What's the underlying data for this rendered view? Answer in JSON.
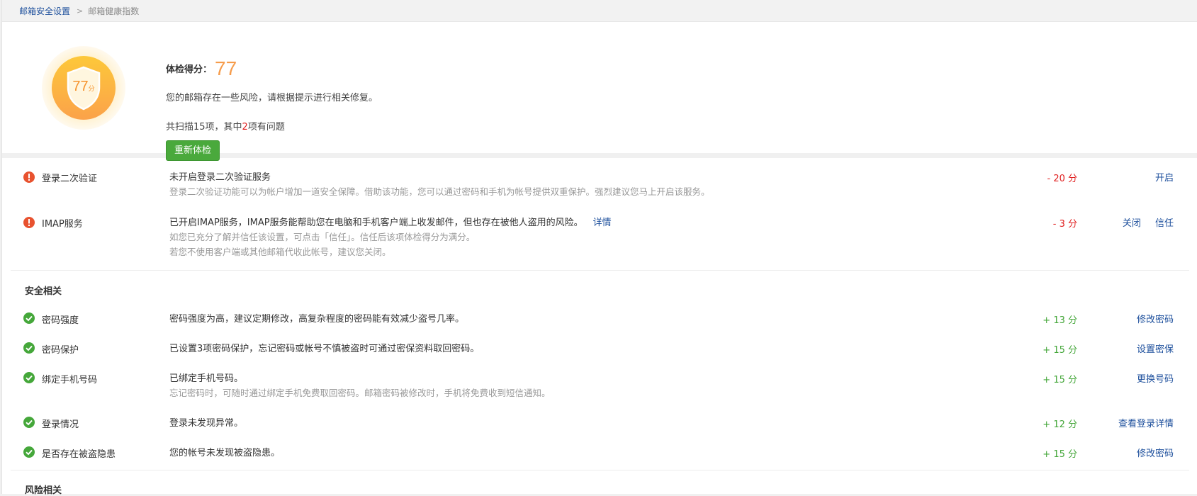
{
  "breadcrumb": {
    "parent": "邮箱安全设置",
    "separator": ">",
    "current": "邮箱健康指数"
  },
  "summary": {
    "badge_score": "77",
    "badge_unit": "分",
    "title": "体检得分：",
    "score": "77",
    "tip": "您的邮箱存在一些风险，请根据提示进行相关修复。",
    "scan_prefix": "共扫描15项，其中",
    "scan_count": "2",
    "scan_suffix": "项有问题",
    "recheck_label": "重新体检"
  },
  "issues": [
    {
      "name": "登录二次验证",
      "desc": "未开启登录二次验证服务",
      "sub1": "登录二次验证功能可以为帐户增加一道安全保障。借助该功能，您可以通过密码和手机为帐号提供双重保护。强烈建议您马上开启该服务。",
      "points": "- 20 分",
      "action": "开启"
    },
    {
      "name": "IMAP服务",
      "desc": "已开启IMAP服务，IMAP服务能帮助您在电脑和手机客户端上收发邮件，但也存在被他人盗用的风险。",
      "detail": "详情",
      "sub1": "如您已充分了解并信任该设置，可点击「信任」。信任后该项体检得分为满分。",
      "sub2": "若您不使用客户端或其他邮箱代收此帐号，建议您关闭。",
      "points": "- 3 分",
      "action": "关闭",
      "action2": "信任"
    }
  ],
  "security_section": {
    "title": "安全相关",
    "items": [
      {
        "name": "密码强度",
        "desc": "密码强度为高，建议定期修改，高复杂程度的密码能有效减少盗号几率。",
        "points": "+ 13 分",
        "action": "修改密码"
      },
      {
        "name": "密码保护",
        "desc": "已设置3项密码保护，忘记密码或帐号不慎被盗时可通过密保资料取回密码。",
        "points": "+ 15 分",
        "action": "设置密保"
      },
      {
        "name": "绑定手机号码",
        "desc": "已绑定手机号码。",
        "sub1": "忘记密码时，可随时通过绑定手机免费取回密码。邮箱密码被修改时，手机将免费收到短信通知。",
        "points": "+ 15 分",
        "action": "更换号码"
      },
      {
        "name": "登录情况",
        "desc": "登录未发现异常。",
        "points": "+ 12 分",
        "action": "查看登录详情"
      },
      {
        "name": "是否存在被盗隐患",
        "desc": "您的帐号未发现被盗隐患。",
        "points": "+ 15 分",
        "action": "修改密码"
      }
    ]
  },
  "risk_section": {
    "title": "风险相关"
  },
  "colors": {
    "link": "#1d4f9c",
    "negative": "#e02020",
    "positive": "#45a73a",
    "score_orange": "#f69c4b",
    "button_green": "#4aa93c"
  }
}
